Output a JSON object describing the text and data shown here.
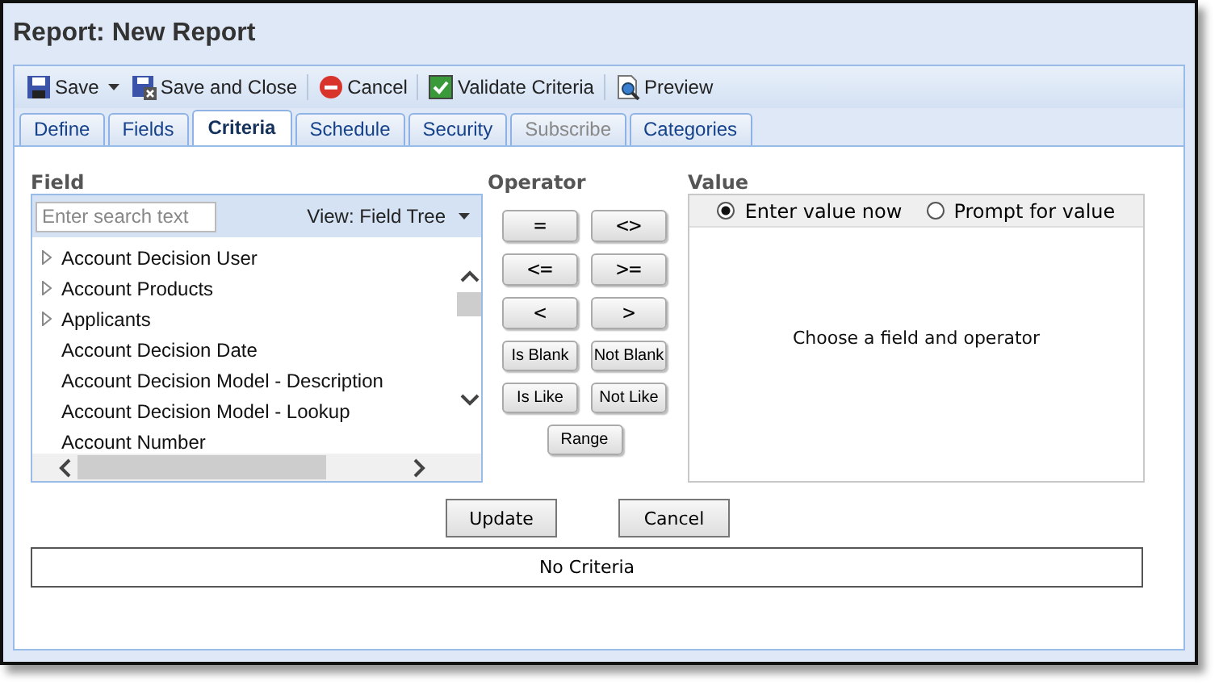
{
  "window": {
    "title": "Report: New Report"
  },
  "toolbar": [
    {
      "kind": "save",
      "label": "Save",
      "has_menu": true
    },
    {
      "kind": "save-close",
      "label": "Save and Close",
      "has_menu": false
    },
    {
      "kind": "cancel",
      "label": "Cancel",
      "has_menu": false
    },
    {
      "kind": "validate",
      "label": "Validate Criteria",
      "has_menu": false
    },
    {
      "kind": "preview",
      "label": "Preview",
      "has_menu": false
    }
  ],
  "tabs": [
    {
      "label": "Define",
      "selected": false,
      "disabled": false
    },
    {
      "label": "Fields",
      "selected": false,
      "disabled": false
    },
    {
      "label": "Criteria",
      "selected": true,
      "disabled": false
    },
    {
      "label": "Schedule",
      "selected": false,
      "disabled": false
    },
    {
      "label": "Security",
      "selected": false,
      "disabled": false
    },
    {
      "label": "Subscribe",
      "selected": false,
      "disabled": true
    },
    {
      "label": "Categories",
      "selected": false,
      "disabled": false
    }
  ],
  "field": {
    "label": "Field",
    "search": {
      "placeholder": "Enter search text"
    },
    "view": "View: Field Tree",
    "items": [
      {
        "label": "Account Decision User",
        "kind": "branch",
        "expanded": false
      },
      {
        "label": "Account Products",
        "kind": "branch",
        "expanded": false
      },
      {
        "label": "Applicants",
        "kind": "branch",
        "expanded": false
      },
      {
        "label": "Account Decision Date",
        "kind": "leaf"
      },
      {
        "label": "Account Decision Model - Description",
        "kind": "leaf"
      },
      {
        "label": "Account Decision Model - Lookup",
        "kind": "leaf"
      },
      {
        "label": "Account Number",
        "kind": "leaf"
      }
    ]
  },
  "operator": {
    "label": "Operator",
    "buttons": [
      "=",
      "<>",
      "<=",
      ">=",
      "<",
      ">",
      "Is Blank",
      "Not Blank",
      "Is Like",
      "Not Like",
      "Range"
    ]
  },
  "value": {
    "label": "Value",
    "options": [
      {
        "label": "Enter value now",
        "selected": true
      },
      {
        "label": "Prompt for value",
        "selected": false
      }
    ],
    "message": "Choose a field and operator"
  },
  "actions": [
    "Update",
    "Cancel"
  ],
  "criteria": "No Criteria"
}
